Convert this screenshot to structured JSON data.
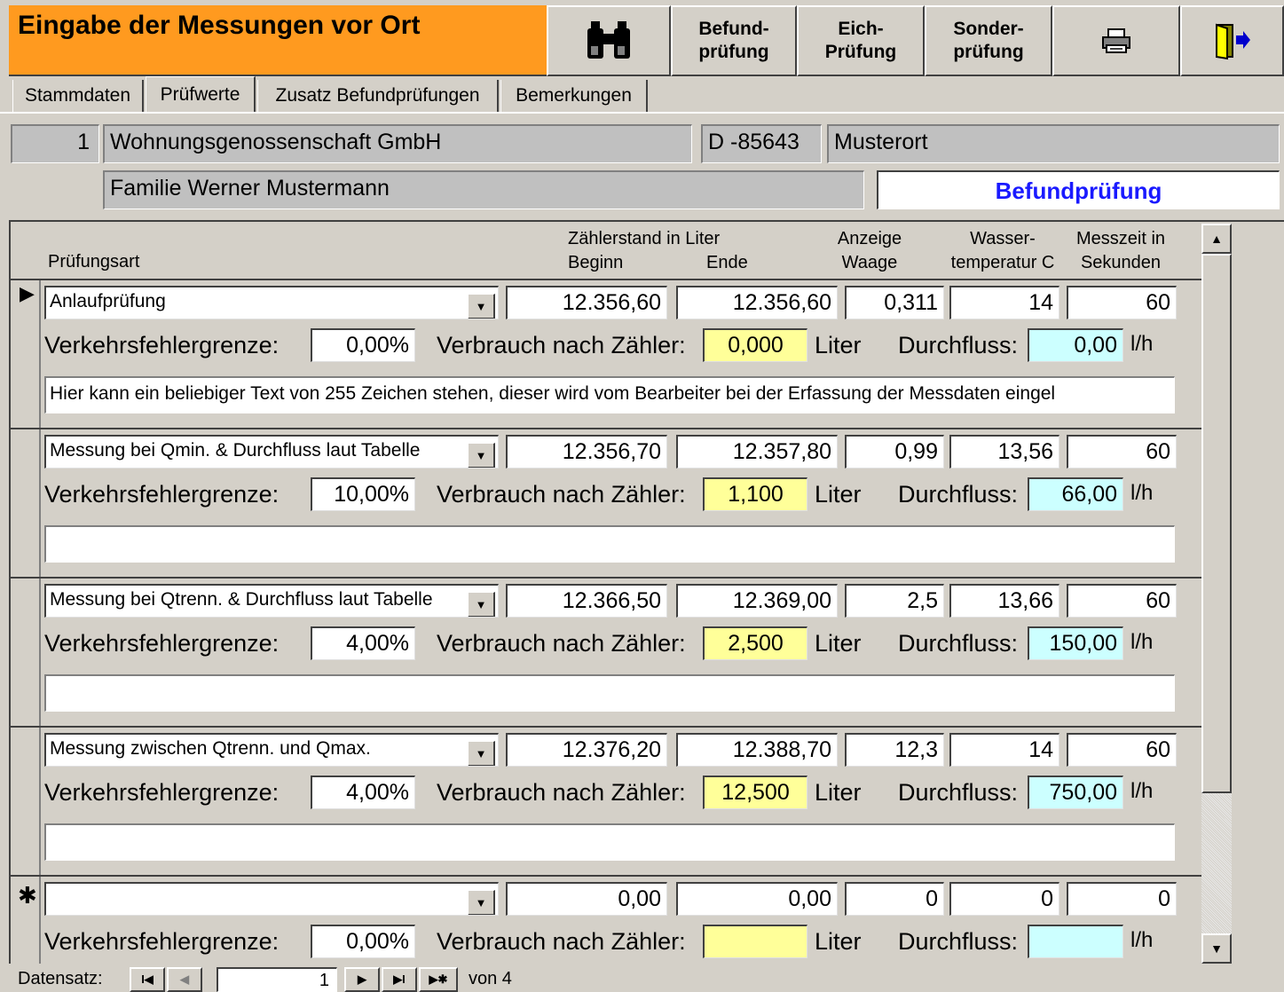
{
  "title": "Eingabe der Messungen vor Ort",
  "toolbar": {
    "search_icon": "binoculars-icon",
    "befund_label": "Befund-\nprüfung",
    "eich_label": "Eich-\nPrüfung",
    "sonder_label": "Sonder-\nprüfung",
    "print_icon": "printer-icon",
    "exit_icon": "exit-door-icon"
  },
  "tabs": [
    "Stammdaten",
    "Prüfwerte",
    "Zusatz Befundprüfungen",
    "Bemerkungen"
  ],
  "record": {
    "number": "1",
    "company": "Wohnungsgenossenschaft GmbH",
    "zip": "D -85643",
    "city": "Musterort",
    "name": "Familie Werner Mustermann",
    "type": "Befundprüfung"
  },
  "columns": {
    "pruefungsart": "Prüfungsart",
    "zaehlerstand": "Zählerstand in Liter",
    "beginn": "Beginn",
    "ende": "Ende",
    "anzeige1": "Anzeige",
    "anzeige2": "Waage",
    "wasser1": "Wasser-",
    "wasser2": "temperatur C",
    "messzeit1": "Messzeit in",
    "messzeit2": "Sekunden"
  },
  "labels": {
    "fehlergrenze": "Verkehrsfehlergrenze:",
    "verbrauch": "Verbrauch nach Zähler:",
    "liter": "Liter",
    "durchfluss": "Durchfluss:",
    "unit": "l/h"
  },
  "rows": [
    {
      "art": "Anlaufprüfung",
      "beginn": "12.356,60",
      "ende": "12.356,60",
      "waage": "0,311",
      "temp": "14",
      "zeit": "60",
      "fehler": "0,00%",
      "verbrauch": "0,000",
      "durchfluss": "0,00",
      "note": "Hier kann ein beliebiger Text von 255 Zeichen stehen, dieser wird vom Bearbeiter bei der Erfassung der Messdaten eingel"
    },
    {
      "art": "Messung bei Qmin. & Durchfluss laut Tabelle",
      "beginn": "12.356,70",
      "ende": "12.357,80",
      "waage": "0,99",
      "temp": "13,56",
      "zeit": "60",
      "fehler": "10,00%",
      "verbrauch": "1,100",
      "durchfluss": "66,00",
      "note": ""
    },
    {
      "art": "Messung bei Qtrenn. & Durchfluss laut Tabelle",
      "beginn": "12.366,50",
      "ende": "12.369,00",
      "waage": "2,5",
      "temp": "13,66",
      "zeit": "60",
      "fehler": "4,00%",
      "verbrauch": "2,500",
      "durchfluss": "150,00",
      "note": ""
    },
    {
      "art": "Messung zwischen Qtrenn. und Qmax.",
      "beginn": "12.376,20",
      "ende": "12.388,70",
      "waage": "12,3",
      "temp": "14",
      "zeit": "60",
      "fehler": "4,00%",
      "verbrauch": "12,500",
      "durchfluss": "750,00",
      "note": ""
    },
    {
      "art": "",
      "beginn": "0,00",
      "ende": "0,00",
      "waage": "0",
      "temp": "0",
      "zeit": "0",
      "fehler": "0,00%",
      "verbrauch": "",
      "durchfluss": "",
      "note": ""
    }
  ],
  "row_markers": {
    "current": "▶",
    "new": "✱"
  },
  "nav": {
    "label": "Datensatz:",
    "current": "1",
    "of_label": "von 4",
    "first": "I◀",
    "prev": "◀",
    "next": "▶",
    "last": "▶I",
    "new": "▶✱"
  },
  "scrollbar": {
    "up": "▲",
    "down": "▼"
  }
}
